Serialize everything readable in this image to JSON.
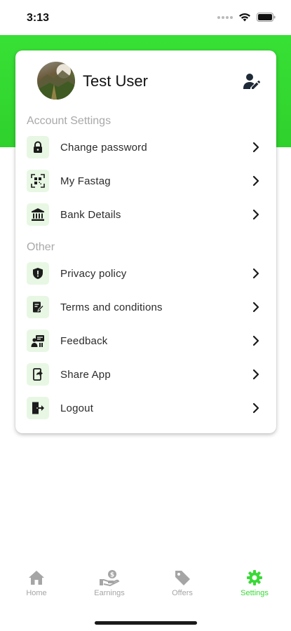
{
  "status_bar": {
    "time": "3:13"
  },
  "profile": {
    "name": "Test User"
  },
  "sections": [
    {
      "title": "Account Settings"
    },
    {
      "title": "Other"
    }
  ],
  "menu": {
    "change_password": "Change password",
    "my_fastag": "My Fastag",
    "bank_details": "Bank Details",
    "privacy_policy": "Privacy policy",
    "terms": "Terms and conditions",
    "feedback": "Feedback",
    "share_app": "Share App",
    "logout": "Logout"
  },
  "bottom_nav": {
    "home": "Home",
    "earnings": "Earnings",
    "offers": "Offers",
    "settings": "Settings",
    "active": "Settings"
  },
  "colors": {
    "accent": "#39d936",
    "icon_bg": "#e7f7e3",
    "section_title": "#a9a9a9",
    "inactive_nav": "#a5a5a5"
  }
}
